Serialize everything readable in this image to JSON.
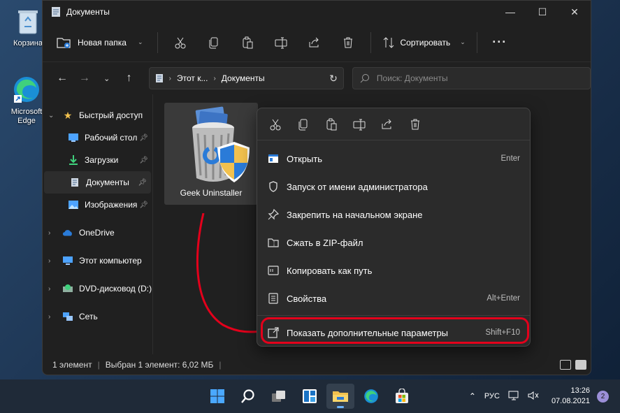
{
  "desktop": {
    "recycle_label": "Корзина",
    "edge_label_1": "Microsoft",
    "edge_label_2": "Edge"
  },
  "window": {
    "title": "Документы",
    "controls": [
      "minimize-icon",
      "maximize-icon",
      "close-icon"
    ]
  },
  "toolbar": {
    "new_folder_label": "Новая папка",
    "sort_label": "Сортировать",
    "icons": [
      "cut-icon",
      "copy-icon",
      "paste-icon",
      "rename-icon",
      "share-icon",
      "delete-icon"
    ],
    "more": "···"
  },
  "address": {
    "crumb1": "Этот к...",
    "crumb2": "Документы",
    "search_placeholder": "Поиск: Документы"
  },
  "sidebar": {
    "quick_access": "Быстрый доступ",
    "items": [
      {
        "label": "Рабочий стол",
        "icon": "desktop-icon"
      },
      {
        "label": "Загрузки",
        "icon": "download-icon"
      },
      {
        "label": "Документы",
        "icon": "document-icon"
      },
      {
        "label": "Изображения",
        "icon": "image-icon"
      }
    ],
    "roots": [
      {
        "label": "OneDrive",
        "icon": "cloud-icon"
      },
      {
        "label": "Этот компьютер",
        "icon": "computer-icon"
      },
      {
        "label": "DVD-дисковод (D:)",
        "icon": "dvd-icon"
      },
      {
        "label": "Сеть",
        "icon": "network-icon"
      }
    ]
  },
  "file": {
    "name": "Geek Uninstaller"
  },
  "context_menu": {
    "icons": [
      "cut-icon",
      "copy-icon",
      "paste-icon",
      "rename-icon",
      "share-icon",
      "delete-icon"
    ],
    "items": [
      {
        "label": "Открыть",
        "shortcut": "Enter"
      },
      {
        "label": "Запуск от имени администратора",
        "shortcut": ""
      },
      {
        "label": "Закрепить на начальном экране",
        "shortcut": ""
      },
      {
        "label": "Сжать в ZIP-файл",
        "shortcut": ""
      },
      {
        "label": "Копировать как путь",
        "shortcut": ""
      },
      {
        "label": "Свойства",
        "shortcut": "Alt+Enter"
      }
    ],
    "more": {
      "label": "Показать дополнительные параметры",
      "shortcut": "Shift+F10"
    }
  },
  "status": {
    "count": "1 элемент",
    "selected": "Выбран 1 элемент: 6,02 МБ"
  },
  "taskbar": {
    "lang": "РУС",
    "time": "13:26",
    "date": "07.08.2021",
    "notifications": "2"
  },
  "colors": {
    "accent_red": "#e3001b",
    "folder_yellow": "#f2c14e",
    "link_blue": "#4da3ff"
  }
}
